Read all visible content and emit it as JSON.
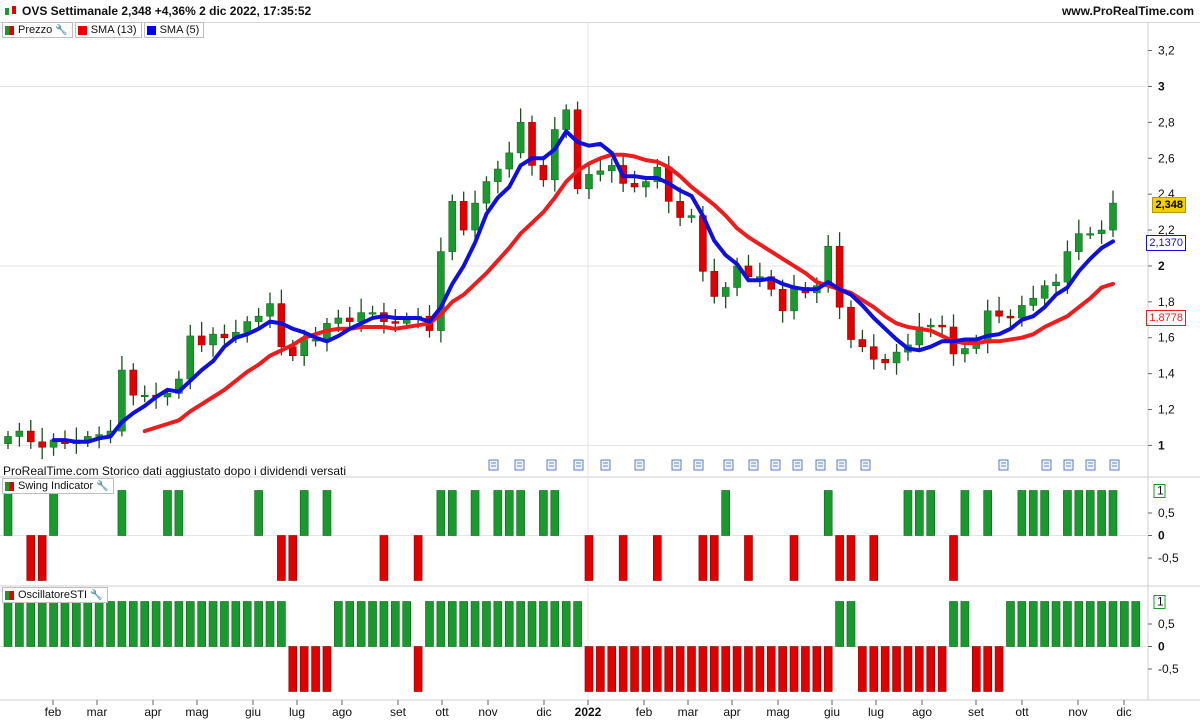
{
  "header": {
    "title": "OVS Settimanale 2,348 +4,36% 2 dic 2022, 17:35:52",
    "brand": "www.ProRealTime.com"
  },
  "legend_main": [
    {
      "label": "Prezzo",
      "color": "#1a8f2a"
    },
    {
      "label": "SMA (13)",
      "color": "#e60000"
    },
    {
      "label": "SMA (5)",
      "color": "#0000e6"
    }
  ],
  "note": "ProRealTime.com  Storico dati aggiustato dopo i dividendi versati",
  "price_tags": {
    "last": "2,348",
    "sma5": "2,1370",
    "sma13": "1,8778"
  },
  "panels": {
    "swing": {
      "label": "Swing Indicator"
    },
    "sti": {
      "label": "OscillatoreSTI"
    }
  },
  "colors": {
    "up": "#1a9a2e",
    "down": "#e00000",
    "sma13": "#ee1c1c",
    "sma5": "#1010dd",
    "grid": "#e4e4e4"
  },
  "chart_data": [
    {
      "type": "candlestick",
      "title": "OVS Settimanale",
      "series": [
        {
          "name": "Prezzo"
        },
        {
          "name": "SMA (13)"
        },
        {
          "name": "SMA (5)"
        }
      ],
      "ylim": [
        0.93,
        3.27
      ],
      "yticks": [
        "1",
        "1,2",
        "1,4",
        "1,6",
        "1,8",
        "2",
        "2,2",
        "2,4",
        "2,6",
        "2,8",
        "3",
        "3,2"
      ],
      "x_labels": [
        "feb",
        "mar",
        "apr",
        "mag",
        "giu",
        "lug",
        "ago",
        "set",
        "ott",
        "nov",
        "dic",
        "2022",
        "feb",
        "mar",
        "apr",
        "mag",
        "giu",
        "lug",
        "ago",
        "set",
        "ott",
        "nov",
        "dic"
      ],
      "close": [
        1.05,
        1.08,
        1.02,
        0.99,
        1.03,
        1.01,
        1.03,
        1.05,
        1.06,
        1.08,
        1.42,
        1.28,
        1.28,
        1.27,
        1.29,
        1.37,
        1.61,
        1.56,
        1.62,
        1.6,
        1.63,
        1.69,
        1.72,
        1.79,
        1.55,
        1.5,
        1.59,
        1.59,
        1.68,
        1.71,
        1.69,
        1.74,
        1.74,
        1.69,
        1.68,
        1.71,
        1.72,
        1.64,
        2.08,
        2.36,
        2.2,
        2.35,
        2.47,
        2.54,
        2.63,
        2.8,
        2.56,
        2.48,
        2.76,
        2.87,
        2.43,
        2.51,
        2.53,
        2.56,
        2.46,
        2.44,
        2.47,
        2.55,
        2.36,
        2.27,
        2.28,
        1.97,
        1.83,
        1.88,
        2.0,
        1.94,
        1.94,
        1.87,
        1.75,
        1.88,
        1.85,
        1.89,
        2.11,
        1.77,
        1.59,
        1.55,
        1.48,
        1.46,
        1.52,
        1.56,
        1.66,
        1.67,
        1.66,
        1.51,
        1.54,
        1.57,
        1.75,
        1.72,
        1.71,
        1.78,
        1.82,
        1.89,
        1.91,
        2.08,
        2.18,
        2.18,
        2.2,
        2.35
      ],
      "sma13": [
        null,
        null,
        null,
        null,
        null,
        null,
        null,
        null,
        null,
        null,
        null,
        null,
        1.08,
        1.1,
        1.12,
        1.14,
        1.19,
        1.23,
        1.27,
        1.31,
        1.36,
        1.41,
        1.45,
        1.5,
        1.53,
        1.56,
        1.6,
        1.62,
        1.64,
        1.65,
        1.65,
        1.66,
        1.66,
        1.66,
        1.65,
        1.66,
        1.67,
        1.68,
        1.73,
        1.8,
        1.84,
        1.9,
        1.96,
        2.03,
        2.1,
        2.18,
        2.24,
        2.3,
        2.38,
        2.47,
        2.53,
        2.57,
        2.6,
        2.62,
        2.62,
        2.61,
        2.59,
        2.58,
        2.55,
        2.5,
        2.44,
        2.39,
        2.34,
        2.28,
        2.21,
        2.16,
        2.12,
        2.08,
        2.04,
        2.0,
        1.96,
        1.91,
        1.89,
        1.87,
        1.85,
        1.81,
        1.77,
        1.72,
        1.68,
        1.66,
        1.65,
        1.64,
        1.61,
        1.58,
        1.57,
        1.57,
        1.58,
        1.58,
        1.59,
        1.6,
        1.62,
        1.66,
        1.69,
        1.72,
        1.77,
        1.82,
        1.88,
        1.9
      ],
      "sma5": [
        null,
        null,
        null,
        null,
        1.03,
        1.03,
        1.02,
        1.02,
        1.04,
        1.05,
        1.13,
        1.18,
        1.22,
        1.27,
        1.31,
        1.3,
        1.36,
        1.42,
        1.47,
        1.55,
        1.6,
        1.62,
        1.65,
        1.69,
        1.68,
        1.65,
        1.63,
        1.6,
        1.58,
        1.61,
        1.65,
        1.68,
        1.71,
        1.72,
        1.71,
        1.71,
        1.71,
        1.69,
        1.77,
        1.9,
        2.0,
        2.13,
        2.29,
        2.38,
        2.44,
        2.56,
        2.6,
        2.6,
        2.65,
        2.75,
        2.69,
        2.67,
        2.68,
        2.63,
        2.5,
        2.5,
        2.49,
        2.49,
        2.46,
        2.42,
        2.39,
        2.28,
        2.14,
        2.06,
        2.01,
        1.92,
        1.92,
        1.93,
        1.9,
        1.88,
        1.87,
        1.87,
        1.91,
        1.87,
        1.84,
        1.78,
        1.71,
        1.65,
        1.59,
        1.54,
        1.53,
        1.55,
        1.58,
        1.58,
        1.59,
        1.59,
        1.61,
        1.62,
        1.65,
        1.7,
        1.72,
        1.77,
        1.84,
        1.88,
        1.97,
        2.04,
        2.1,
        2.137
      ]
    },
    {
      "type": "bar",
      "title": "Swing Indicator",
      "ylim": [
        -1.05,
        1.05
      ],
      "yticks": [
        "0",
        "0,5",
        "-0,5"
      ],
      "axis_marker": "1",
      "values": [
        1,
        0,
        -1,
        -1,
        1,
        0,
        0,
        0,
        0,
        0,
        1,
        0,
        0,
        0,
        1,
        1,
        0,
        0,
        0,
        0,
        0,
        0,
        1,
        0,
        -1,
        -1,
        1,
        0,
        1,
        0,
        0,
        0,
        0,
        -1,
        0,
        0,
        -1,
        0,
        1,
        1,
        0,
        1,
        0,
        1,
        1,
        1,
        0,
        1,
        1,
        0,
        0,
        -1,
        0,
        0,
        -1,
        0,
        0,
        -1,
        0,
        0,
        0,
        -1,
        -1,
        1,
        0,
        -1,
        0,
        0,
        0,
        -1,
        0,
        0,
        1,
        -1,
        -1,
        0,
        -1,
        0,
        0,
        1,
        1,
        1,
        0,
        -1,
        1,
        0,
        1,
        0,
        0,
        1,
        1,
        1,
        0,
        1,
        1,
        1,
        1,
        1
      ]
    },
    {
      "type": "bar",
      "title": "OscillatoreSTI",
      "ylim": [
        -1.05,
        1.05
      ],
      "yticks": [
        "0",
        "0,5",
        "-0,5"
      ],
      "axis_marker": "1",
      "values": [
        1,
        1,
        1,
        1,
        1,
        1,
        1,
        1,
        1,
        1,
        1,
        1,
        1,
        1,
        1,
        1,
        1,
        1,
        1,
        1,
        1,
        1,
        1,
        1,
        1,
        -1,
        -1,
        -1,
        -1,
        1,
        1,
        1,
        1,
        1,
        1,
        1,
        -1,
        1,
        1,
        1,
        1,
        1,
        1,
        1,
        1,
        1,
        1,
        1,
        1,
        1,
        1,
        -1,
        -1,
        -1,
        -1,
        -1,
        -1,
        -1,
        -1,
        -1,
        -1,
        -1,
        -1,
        -1,
        -1,
        -1,
        -1,
        -1,
        -1,
        -1,
        -1,
        -1,
        -1,
        1,
        1,
        -1,
        -1,
        -1,
        -1,
        -1,
        -1,
        -1,
        -1,
        1,
        1,
        -1,
        -1,
        -1,
        1,
        1,
        1,
        1,
        1,
        1,
        1,
        1,
        1,
        1,
        1,
        1
      ]
    }
  ]
}
